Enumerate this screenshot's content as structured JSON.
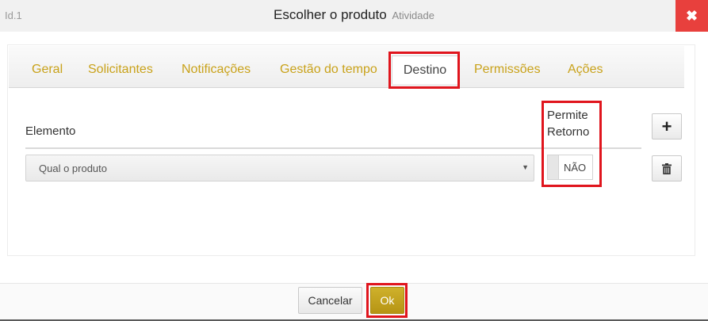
{
  "window": {
    "id_label": "Id.1",
    "title": "Escolher o produto",
    "subtitle": "Atividade",
    "close_icon": "close-icon"
  },
  "tabs": [
    {
      "label": "Geral",
      "active": false
    },
    {
      "label": "Solicitantes",
      "active": false
    },
    {
      "label": "Notificações",
      "active": false
    },
    {
      "label": "Gestão do tempo",
      "active": false
    },
    {
      "label": "Destino",
      "active": true
    },
    {
      "label": "Permissões",
      "active": false
    },
    {
      "label": "Ações",
      "active": false
    }
  ],
  "table": {
    "headers": {
      "element": "Elemento",
      "allow_return_line1": "Permite",
      "allow_return_line2": "Retorno"
    },
    "rows": [
      {
        "element": "Qual o produto",
        "allow_return": "NÃO"
      }
    ]
  },
  "buttons": {
    "add_icon": "plus-icon",
    "delete_icon": "trash-icon",
    "cancel": "Cancelar",
    "ok": "Ok"
  },
  "colors": {
    "accent": "#c9a21a",
    "highlight": "#e0151d",
    "close": "#e8403d",
    "ok_button": "#c1a01f"
  }
}
